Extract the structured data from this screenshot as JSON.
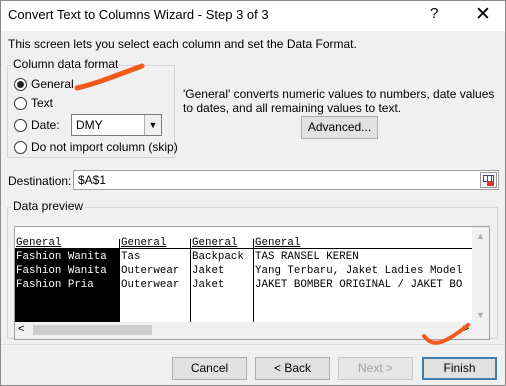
{
  "window": {
    "title": "Convert Text to Columns Wizard - Step 3 of 3",
    "help_label": "?",
    "close_label": "✕"
  },
  "description": "This screen lets you select each column and set the Data Format.",
  "column_format": {
    "legend": "Column data format",
    "options": [
      {
        "label": "General",
        "selected": true
      },
      {
        "label": "Text",
        "selected": false
      },
      {
        "label": "Date:",
        "selected": false
      },
      {
        "label": "Do not import column (skip)",
        "selected": false
      }
    ],
    "date_format": {
      "value": "DMY"
    }
  },
  "info_text": "'General' converts numeric values to numbers, date values to dates, and all remaining values to text.",
  "advanced_label": "Advanced...",
  "destination": {
    "label": "Destination:",
    "value": "$A$1"
  },
  "preview": {
    "legend": "Data preview",
    "headers": [
      "General",
      "General",
      "General",
      "General"
    ],
    "rows": [
      [
        "Fashion Wanita",
        "Tas",
        "Backpack",
        "TAS RANSEL KEREN"
      ],
      [
        "Fashion Wanita",
        "Outerwear",
        "Jaket",
        "Yang Terbaru, Jaket Ladies Model"
      ],
      [
        "Fashion Pria",
        "Outerwear",
        "Jaket",
        "JAKET BOMBER ORIGINAL / JAKET BO"
      ]
    ]
  },
  "buttons": {
    "cancel": "Cancel",
    "back": "< Back",
    "next": "Next >",
    "finish": "Finish"
  },
  "colors": {
    "annotation": "#f25a1d",
    "selection": "#000000",
    "accent": "#3c7fb1"
  }
}
